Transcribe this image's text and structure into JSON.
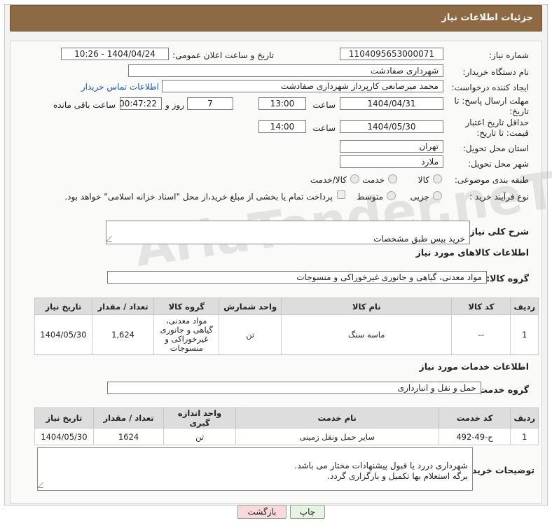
{
  "header": {
    "title": "جزئیات اطلاعات نیاز"
  },
  "form": {
    "need_number_label": "شماره نیاز:",
    "need_number": "1104095653000071",
    "announce_label": "تاریخ و ساعت اعلان عمومی:",
    "announce_value": "1404/04/24 - 10:26",
    "buyer_org_label": "نام دستگاه خریدار:",
    "buyer_org": "شهرداری صفادشت",
    "creator_label": "ایجاد کننده درخواست:",
    "creator": "محمد میرصانعی کارپرداز شهرداری صفادشت",
    "contact_link": "اطلاعات تماس خریدار",
    "reply_deadline_label": "مهلت ارسال پاسخ: تا تاریخ:",
    "reply_date": "1404/04/31",
    "hour_label": "ساعت",
    "reply_time": "13:00",
    "days_value": "7",
    "days_label": "روز و",
    "remaining_time": "00:47:22",
    "remaining_label": "ساعت باقی مانده",
    "price_validity_label": "حداقل تاریخ اعتبار قیمت: تا تاریخ:",
    "price_date": "1404/05/30",
    "price_time": "14:00",
    "province_label": "استان محل تحویل:",
    "province": "تهران",
    "city_label": "شهر محل تحویل:",
    "city": "ملارد",
    "category_label": "طبقه بندی موضوعی:",
    "category_options": [
      "کالا",
      "خدمت",
      "کالا/خدمت"
    ],
    "process_label": "نوع فرآیند خرید :",
    "process_options": [
      "جزیی",
      "متوسط"
    ],
    "payment_note": "پرداخت تمام یا بخشی از مبلغ خرید،از محل \"اسناد خزانه اسلامی\" خواهد بود."
  },
  "description": {
    "label": "شرح کلی نیاز:",
    "value": "خرید بیس طبق مشخصات"
  },
  "goods": {
    "section_title": "اطلاعات کالاهای مورد نیاز",
    "group_label": "گروه کالا:",
    "group_value": "مواد معدنی، گیاهی و جانوری غیرخوراکی و منسوجات",
    "columns": [
      "ردیف",
      "کد کالا",
      "نام کالا",
      "واحد شمارش",
      "گروه کالا",
      "تعداد / مقدار",
      "تاریخ نیاز"
    ],
    "rows": [
      {
        "row": "1",
        "code": "--",
        "name": "ماسه سنگ",
        "unit": "تن",
        "group": "مواد معدنی، گیاهی و جانوری غیرخوراکی و منسوجات",
        "qty": "1,624",
        "date": "1404/05/30"
      }
    ]
  },
  "services": {
    "section_title": "اطلاعات خدمات مورد نیاز",
    "group_label": "گروه خدمت:",
    "group_value": "حمل و نقل و انبارداری",
    "columns": [
      "ردیف",
      "کد خدمت",
      "نام خدمت",
      "واحد اندازه گیری",
      "تعداد / مقدار",
      "تاریخ نیاز"
    ],
    "rows": [
      {
        "row": "1",
        "code": "ح-49-492",
        "name": "سایر حمل ونقل زمینی",
        "unit": "تن",
        "qty": "1624",
        "date": "1404/05/30"
      }
    ]
  },
  "buyer_notes": {
    "label": "توضیحات خریدار:",
    "value": "شهرداری دررد یا قبول پیشنهادات مختار می باشد.\nبرگه استعلام بها تکمیل و بارگزاری گردد."
  },
  "buttons": {
    "print": "چاپ",
    "back": "بازگشت"
  },
  "watermark": "AriaTender.neT",
  "colors": {
    "header_bg": "#8d6a43",
    "link": "#1a56b8",
    "back_button_bg": "#f9dada",
    "print_button_bg": "#e6f5e2"
  }
}
